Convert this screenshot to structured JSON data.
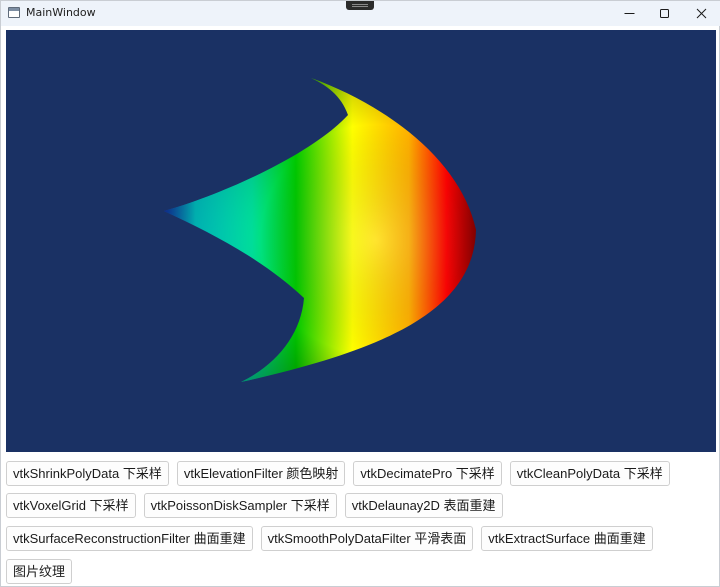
{
  "window": {
    "title": "MainWindow",
    "icon": "window-app-icon"
  },
  "title_controls": [
    "minimize-icon",
    "maximize-icon",
    "close-icon"
  ],
  "viewport": {
    "background": "#1a3164",
    "colormap": [
      "#1a4dff",
      "#00ffff",
      "#00c800",
      "#ffff00",
      "#ff0000"
    ]
  },
  "buttons": [
    [
      "vtkShrinkPolyData 下采样",
      "vtkElevationFilter 颜色映射",
      "vtkDecimatePro 下采样",
      "vtkCleanPolyData 下采样"
    ],
    [
      "vtkVoxelGrid 下采样",
      "vtkPoissonDiskSampler 下采样",
      "vtkDelaunay2D 表面重建"
    ],
    [
      "vtkSurfaceReconstructionFilter 曲面重建",
      "vtkSmoothPolyDataFilter 平滑表面",
      "vtkExtractSurface 曲面重建"
    ],
    [
      "图片纹理"
    ]
  ]
}
